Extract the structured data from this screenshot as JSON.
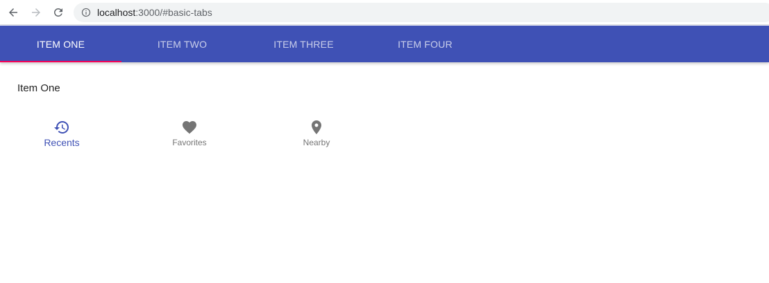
{
  "browser": {
    "url_host": "localhost",
    "url_rest": ":3000/#basic-tabs",
    "icons": [
      "back-arrow-icon",
      "forward-arrow-icon",
      "reload-icon",
      "info-icon"
    ]
  },
  "tabs": [
    {
      "label": "ITEM ONE",
      "active": true
    },
    {
      "label": "ITEM TWO",
      "active": false
    },
    {
      "label": "ITEM THREE",
      "active": false
    },
    {
      "label": "ITEM FOUR",
      "active": false
    }
  ],
  "panel": {
    "text": "Item One"
  },
  "bottom_nav": [
    {
      "label": "Recents",
      "icon": "history-icon",
      "selected": true
    },
    {
      "label": "Favorites",
      "icon": "heart-icon",
      "selected": false
    },
    {
      "label": "Nearby",
      "icon": "location-pin-icon",
      "selected": false
    }
  ],
  "colors": {
    "primary": "#3f51b5",
    "indicator": "#f50057",
    "inactive_icon": "#757575"
  }
}
